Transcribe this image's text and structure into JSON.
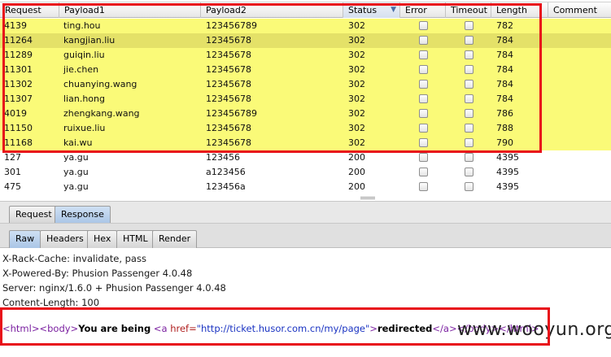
{
  "columns": [
    "Request",
    "Payload1",
    "Payload2",
    "Status",
    "Error",
    "Timeout",
    "Length",
    "Comment"
  ],
  "rows": [
    {
      "request": "4139",
      "payload1": "ting.hou",
      "payload2": "123456789",
      "status": "302",
      "error": false,
      "timeout": false,
      "length": "782",
      "highlight": true,
      "selected": false
    },
    {
      "request": "11264",
      "payload1": "kangjian.liu",
      "payload2": "12345678",
      "status": "302",
      "error": false,
      "timeout": false,
      "length": "784",
      "highlight": true,
      "selected": true
    },
    {
      "request": "11289",
      "payload1": "guiqin.liu",
      "payload2": "12345678",
      "status": "302",
      "error": false,
      "timeout": false,
      "length": "784",
      "highlight": true,
      "selected": false
    },
    {
      "request": "11301",
      "payload1": "jie.chen",
      "payload2": "12345678",
      "status": "302",
      "error": false,
      "timeout": false,
      "length": "784",
      "highlight": true,
      "selected": false
    },
    {
      "request": "11302",
      "payload1": "chuanying.wang",
      "payload2": "12345678",
      "status": "302",
      "error": false,
      "timeout": false,
      "length": "784",
      "highlight": true,
      "selected": false
    },
    {
      "request": "11307",
      "payload1": "lian.hong",
      "payload2": "12345678",
      "status": "302",
      "error": false,
      "timeout": false,
      "length": "784",
      "highlight": true,
      "selected": false
    },
    {
      "request": "4019",
      "payload1": "zhengkang.wang",
      "payload2": "123456789",
      "status": "302",
      "error": false,
      "timeout": false,
      "length": "786",
      "highlight": true,
      "selected": false
    },
    {
      "request": "11150",
      "payload1": "ruixue.liu",
      "payload2": "12345678",
      "status": "302",
      "error": false,
      "timeout": false,
      "length": "788",
      "highlight": true,
      "selected": false
    },
    {
      "request": "11168",
      "payload1": "kai.wu",
      "payload2": "12345678",
      "status": "302",
      "error": false,
      "timeout": false,
      "length": "790",
      "highlight": true,
      "selected": false
    },
    {
      "request": "127",
      "payload1": "ya.gu",
      "payload2": "123456",
      "status": "200",
      "error": false,
      "timeout": false,
      "length": "4395",
      "highlight": false,
      "selected": false
    },
    {
      "request": "301",
      "payload1": "ya.gu",
      "payload2": "a123456",
      "status": "200",
      "error": false,
      "timeout": false,
      "length": "4395",
      "highlight": false,
      "selected": false
    },
    {
      "request": "475",
      "payload1": "ya.gu",
      "payload2": "123456a",
      "status": "200",
      "error": false,
      "timeout": false,
      "length": "4395",
      "highlight": false,
      "selected": false
    }
  ],
  "sort_icon": "triangle-down-icon",
  "tabs_primary": [
    "Request",
    "Response"
  ],
  "tabs_primary_active": "Response",
  "tabs_secondary": [
    "Raw",
    "Headers",
    "Hex",
    "HTML",
    "Render"
  ],
  "tabs_secondary_active": "Raw",
  "response": {
    "headers": [
      "X-Rack-Cache: invalidate, pass",
      "X-Powered-By: Phusion Passenger 4.0.48",
      "Server: nginx/1.6.0 + Phusion Passenger 4.0.48",
      "Content-Length: 100"
    ],
    "body": {
      "open_html": "<html>",
      "open_body": "<body>",
      "text1": "You are being",
      "a_open": "<a",
      "href_attr": "href=",
      "href_value": "\"http://ticket.husor.com.cn/my/page\"",
      "a_close_bracket": ">",
      "text2": "redirected",
      "close_a": "</a>",
      "close_body": "</body>",
      "close_html": "</html>"
    }
  },
  "watermark": "www.wooyun.org",
  "colors": {
    "highlight_row": "#fafa78",
    "selected_row": "#e4e168",
    "annotation_box": "#e8101a"
  }
}
